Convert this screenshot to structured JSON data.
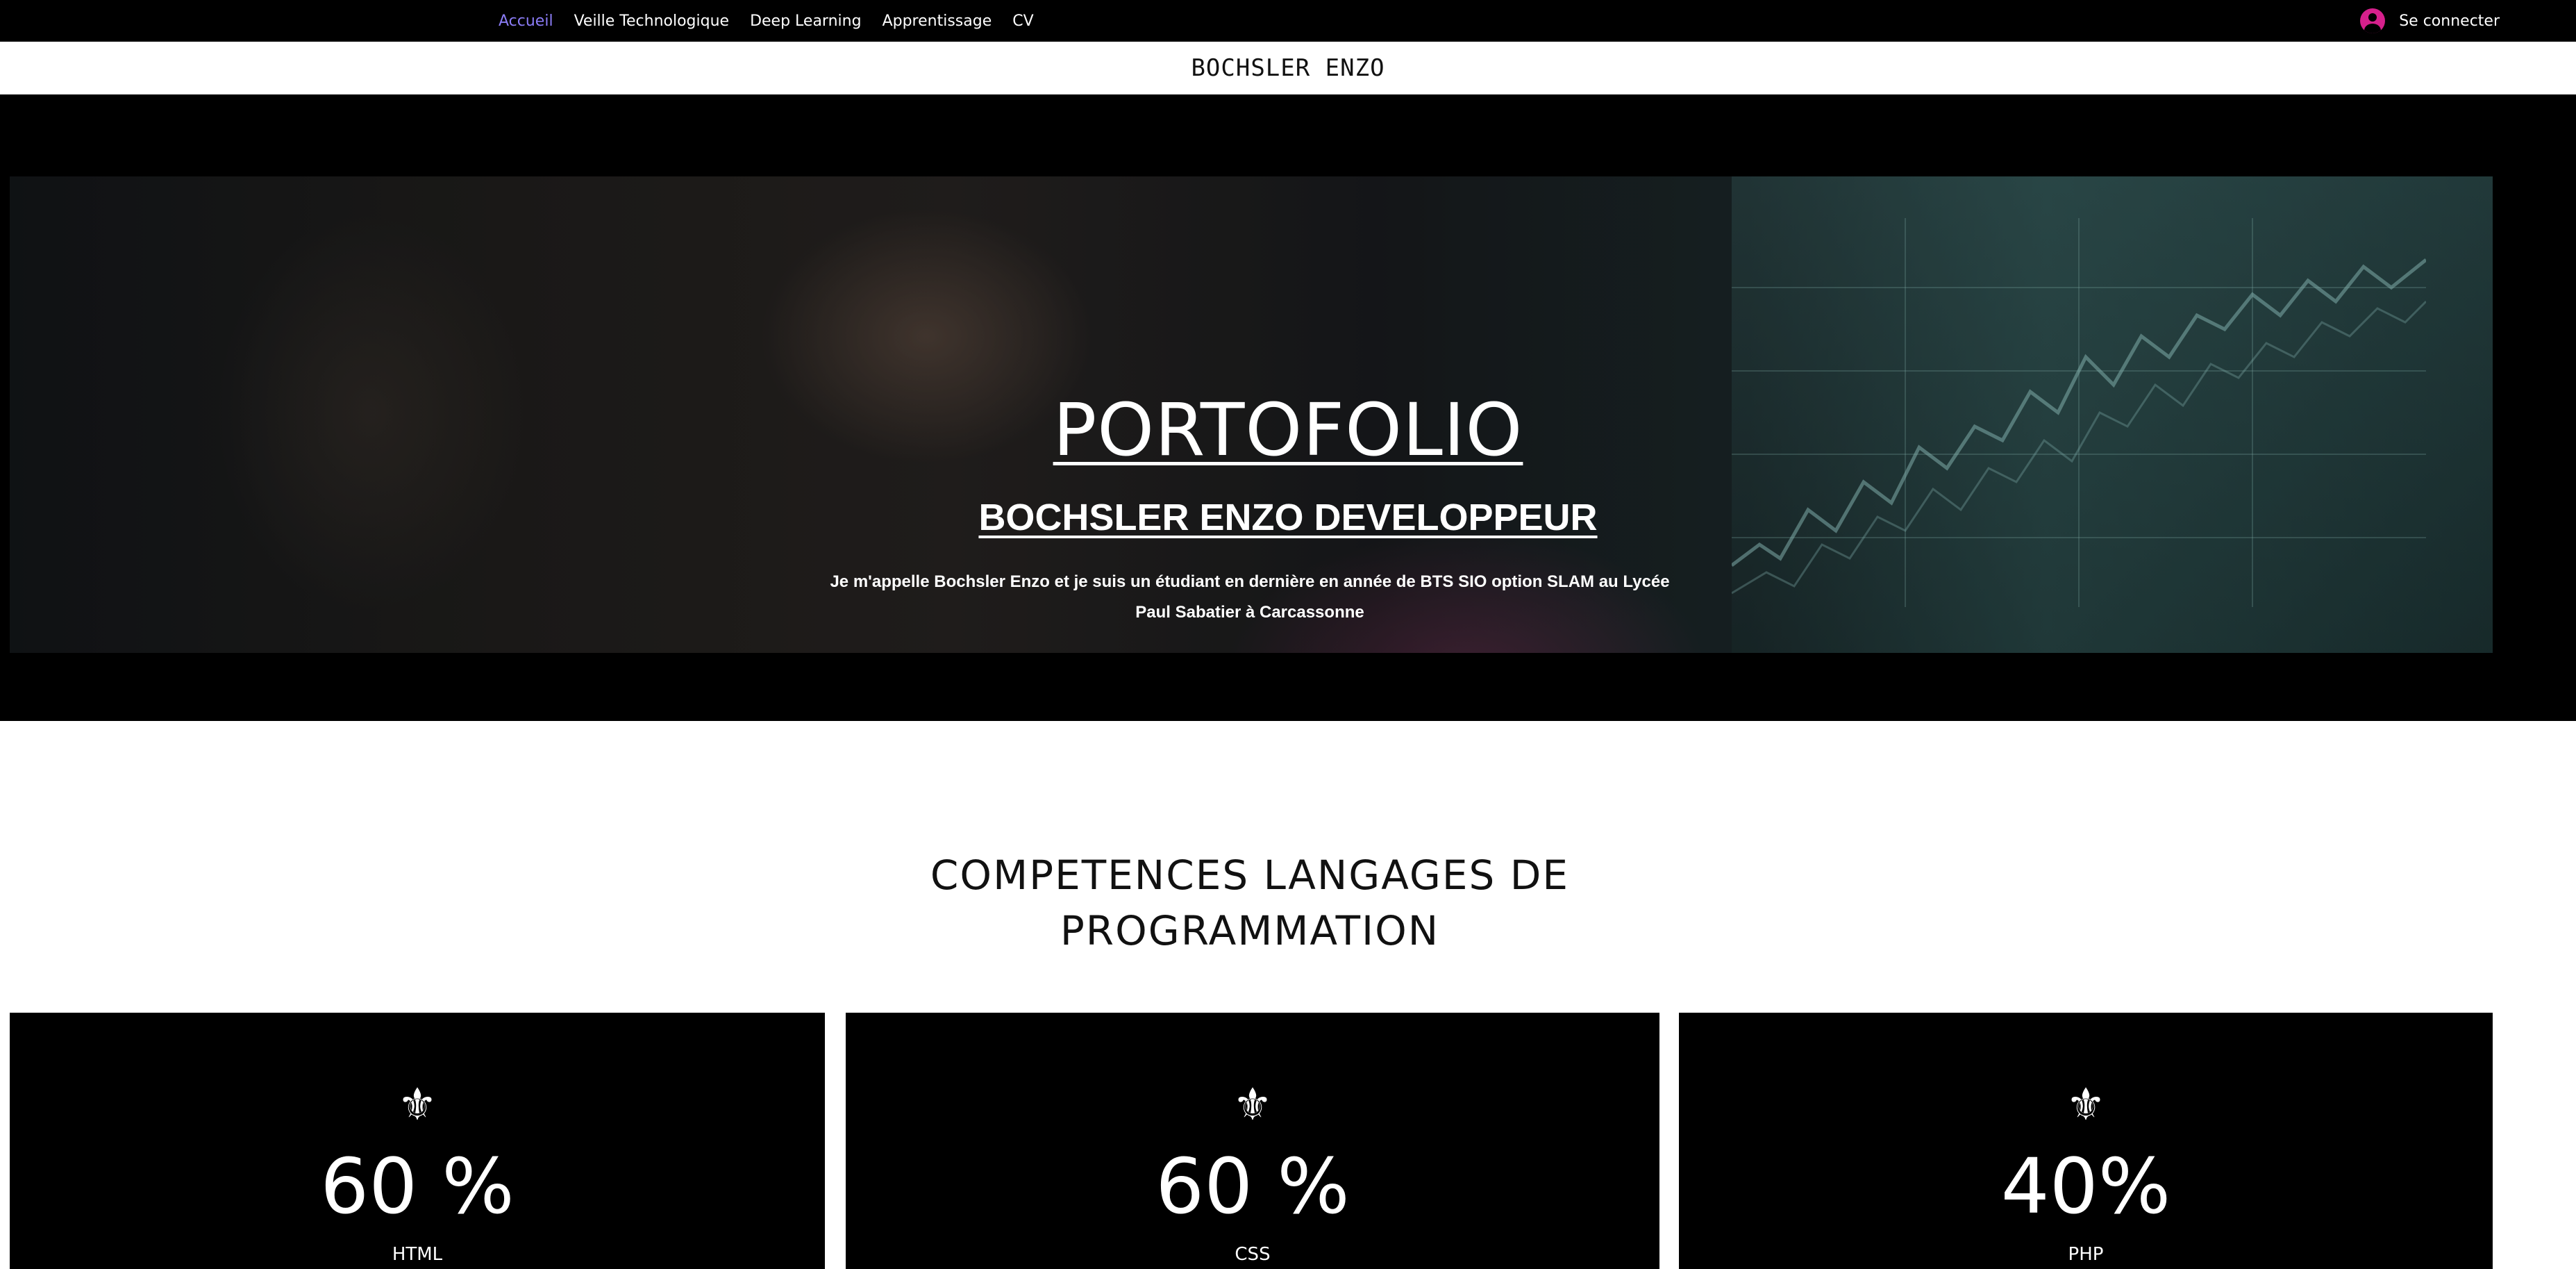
{
  "nav": {
    "items": [
      {
        "label": "Accueil",
        "active": true
      },
      {
        "label": "Veille Technologique",
        "active": false
      },
      {
        "label": "Deep Learning",
        "active": false
      },
      {
        "label": "Apprentissage",
        "active": false
      },
      {
        "label": "CV",
        "active": false
      }
    ],
    "login_label": "Se connecter",
    "avatar_icon": "user-avatar-icon",
    "active_color": "#8b7cf6",
    "avatar_color": "#d6208c"
  },
  "site": {
    "title": "BOCHSLER ENZO"
  },
  "hero": {
    "heading": "PORTOFOLIO",
    "subheading": "BOCHSLER ENZO DEVELOPPEUR",
    "description_line1": "Je m'appelle Bochsler Enzo et je suis un étudiant en dernière en année de BTS SIO option SLAM au Lycée",
    "description_line2": "Paul Sabatier à Carcassonne"
  },
  "skills": {
    "title_line1": "COMPETENCES LANGAGES DE",
    "title_line2": "PROGRAMMATION",
    "icon": "fleur-de-lis-icon",
    "cards": [
      {
        "value": "60 %",
        "label": "HTML"
      },
      {
        "value": "60 %",
        "label": "CSS"
      },
      {
        "value": "40%",
        "label": "PHP"
      }
    ]
  }
}
